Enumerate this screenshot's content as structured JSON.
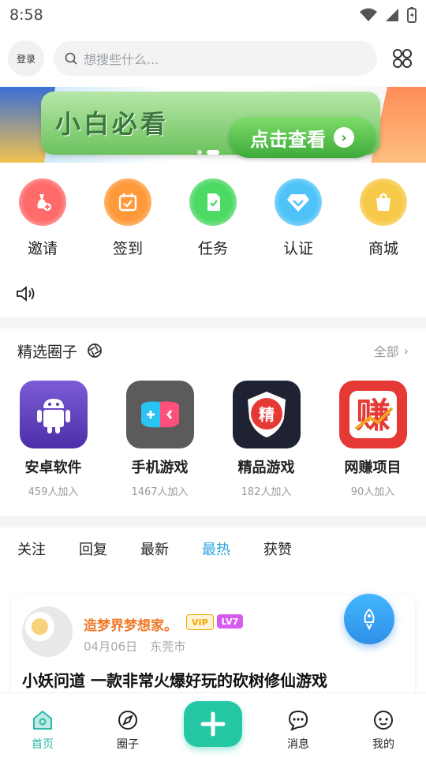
{
  "status": {
    "time": "8:58"
  },
  "header": {
    "login_label": "登录",
    "search_placeholder": "想搜些什么..."
  },
  "banner": {
    "title": "小白必看",
    "cta": "点击查看"
  },
  "quick_actions": [
    {
      "label": "邀请",
      "icon": "invite-icon",
      "color": "#ff6b6b"
    },
    {
      "label": "签到",
      "icon": "checkin-calendar-icon",
      "color": "#ff9a3c"
    },
    {
      "label": "任务",
      "icon": "task-doc-icon",
      "color": "#4cd964"
    },
    {
      "label": "认证",
      "icon": "verify-diamond-icon",
      "color": "#4fc3f7"
    },
    {
      "label": "商城",
      "icon": "shop-bag-icon",
      "color": "#f7c948"
    }
  ],
  "circles_section": {
    "title": "精选圈子",
    "all_label": "全部",
    "items": [
      {
        "name": "安卓软件",
        "members": "459人加入",
        "icon": "android-icon"
      },
      {
        "name": "手机游戏",
        "members": "1467人加入",
        "icon": "gamepad-icon"
      },
      {
        "name": "精品游戏",
        "members": "182人加入",
        "icon": "premium-shield-icon",
        "badge_text": "精"
      },
      {
        "name": "网赚项目",
        "members": "90人加入",
        "icon": "earn-money-icon",
        "badge_text": "赚"
      }
    ]
  },
  "feed_tabs": [
    {
      "label": "关注",
      "active": false
    },
    {
      "label": "回复",
      "active": false
    },
    {
      "label": "最新",
      "active": false
    },
    {
      "label": "最热",
      "active": true
    },
    {
      "label": "获赞",
      "active": false
    }
  ],
  "post": {
    "author": "造梦界梦想家。",
    "vip_label": "VIP",
    "level_label": "LV7",
    "date": "04月06日",
    "location": "东莞市",
    "title": "小妖问道 一款非常火爆好玩的砍树修仙游戏"
  },
  "bottom_nav": [
    {
      "label": "首页",
      "icon": "home-icon",
      "active": true
    },
    {
      "label": "圈子",
      "icon": "compass-icon",
      "active": false
    },
    {
      "label": "",
      "icon": "plus-icon",
      "active": false
    },
    {
      "label": "消息",
      "icon": "message-icon",
      "active": false
    },
    {
      "label": "我的",
      "icon": "profile-icon",
      "active": false
    }
  ],
  "colors": {
    "accent": "#2ea3e0",
    "nav_active": "#2bb9a8",
    "plus_bg": "#25c7a4"
  }
}
